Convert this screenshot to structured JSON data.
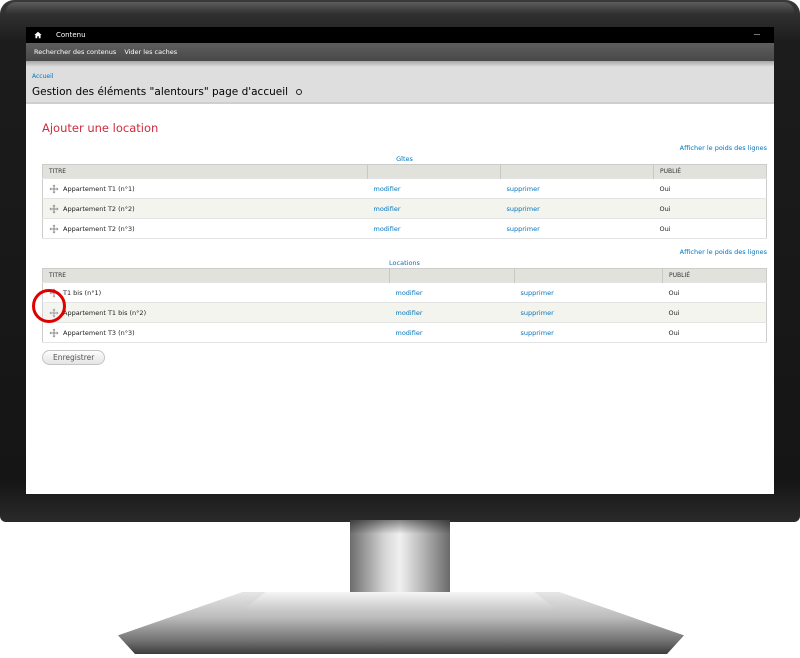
{
  "toolbar": {
    "home_icon": "home-icon",
    "content_label": "Contenu"
  },
  "shortcuts": {
    "items": [
      "Rechercher des contenus",
      "Vider les caches"
    ]
  },
  "header": {
    "breadcrumb": "Accueil",
    "title": "Gestion des éléments \"alentours\" page d'accueil"
  },
  "main": {
    "add_heading": "Ajouter une location",
    "weights_link": "Afficher le poids des lignes",
    "columns": [
      "TITRE",
      "",
      "",
      "PUBLIÉ"
    ],
    "tables": [
      {
        "caption": "Gîtes",
        "rows": [
          {
            "title": "Appartement T1 (n°1)",
            "edit": "modifier",
            "delete": "supprimer",
            "published": "Oui"
          },
          {
            "title": "Appartement T2 (n°2)",
            "edit": "modifier",
            "delete": "supprimer",
            "published": "Oui"
          },
          {
            "title": "Appartement T2 (n°3)",
            "edit": "modifier",
            "delete": "supprimer",
            "published": "Oui"
          }
        ]
      },
      {
        "caption": "Locations",
        "rows": [
          {
            "title": "T1 bis (n°1)",
            "edit": "modifier",
            "delete": "supprimer",
            "published": "Oui"
          },
          {
            "title": "Appartement T1 bis (n°2)",
            "edit": "modifier",
            "delete": "supprimer",
            "published": "Oui"
          },
          {
            "title": "Appartement T3 (n°3)",
            "edit": "modifier",
            "delete": "supprimer",
            "published": "Oui"
          }
        ]
      }
    ],
    "save_label": "Enregistrer"
  },
  "colors": {
    "heading": "#d12a3c",
    "link": "#0074bd",
    "highlight": "#e00000"
  }
}
